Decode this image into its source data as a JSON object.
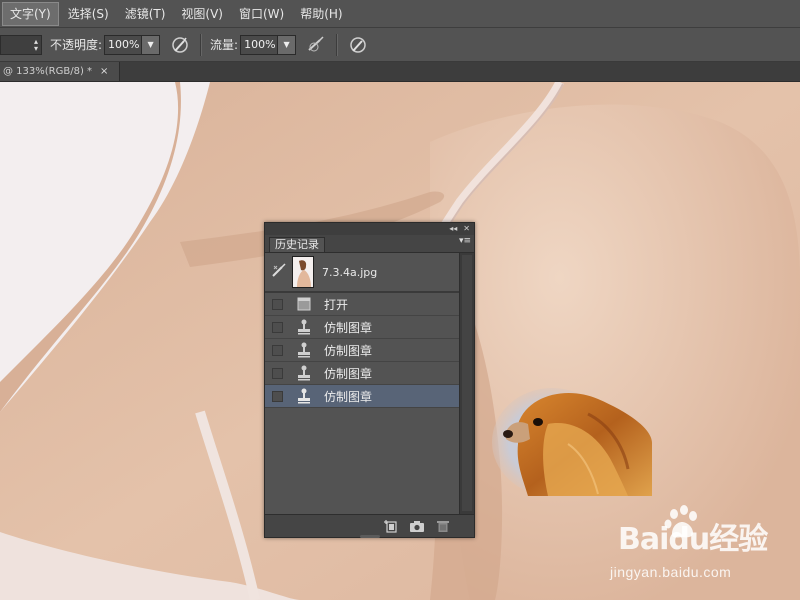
{
  "menu": {
    "items": [
      "文字(Y)",
      "选择(S)",
      "滤镜(T)",
      "视图(V)",
      "窗口(W)",
      "帮助(H)"
    ],
    "active_index": 0
  },
  "options_bar": {
    "opacity_label": "不透明度:",
    "opacity_value": "100%",
    "flow_label": "流量:",
    "flow_value": "100%"
  },
  "document_tab": {
    "title": "@ 133%(RGB/8) *",
    "close": "×"
  },
  "history_panel": {
    "tab_label": "历史记录",
    "collapse_glyph": "◂◂",
    "close_glyph": "✕",
    "menu_glyph": "▾≡",
    "snapshot_name": "7.3.4a.jpg",
    "items": [
      {
        "label": "打开",
        "icon": "open-document-icon"
      },
      {
        "label": "仿制图章",
        "icon": "clone-stamp-icon"
      },
      {
        "label": "仿制图章",
        "icon": "clone-stamp-icon"
      },
      {
        "label": "仿制图章",
        "icon": "clone-stamp-icon"
      },
      {
        "label": "仿制图章",
        "icon": "clone-stamp-icon"
      }
    ],
    "selected_index": 4
  },
  "watermark": {
    "brand": "Baidu经验",
    "url": "jingyan.baidu.com"
  },
  "colors": {
    "ui_gray": "#535353",
    "selected_row": "#586477",
    "skin": "#e2bfa6"
  }
}
